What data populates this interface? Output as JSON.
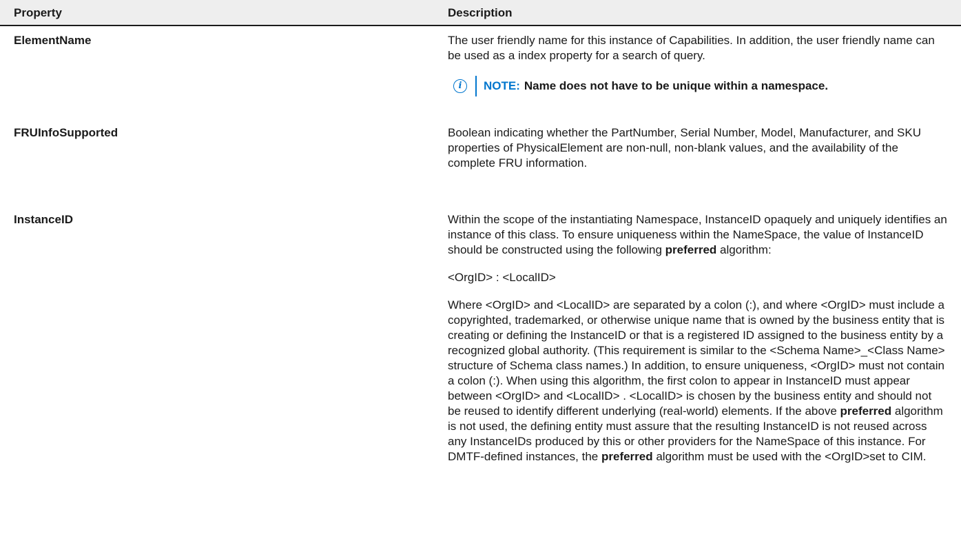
{
  "header": {
    "property": "Property",
    "description": "Description"
  },
  "rows": [
    {
      "name": "ElementName",
      "desc": "The user friendly name for this instance of Capabilities. In addition, the user friendly name can be used as a index property for a search of query.",
      "note": {
        "label": "NOTE:",
        "text": "Name does not have to be unique within a namespace."
      }
    },
    {
      "name": "FRUInfoSupported",
      "desc": "Boolean indicating whether the PartNumber, Serial Number, Model, Manufacturer, and SKU properties of PhysicalElement are non-null, non-blank values, and the availability of the complete FRU information."
    },
    {
      "name": "InstanceID",
      "p1a": "Within the scope of the instantiating Namespace, InstanceID opaquely and uniquely identifies an instance of this class. To ensure uniqueness within the NameSpace, the value of InstanceID should be constructed using the following ",
      "p1b": "preferred",
      "p1c": " algorithm:",
      "p2": "<OrgID> : <LocalID>",
      "p3a": "Where <OrgID> and <LocalID> are separated by a colon (:), and where <OrgID> must include a copyrighted, trademarked, or otherwise unique name that is owned by the business entity that is creating or defining the InstanceID or that is a registered ID assigned to the business entity by a recognized global authority. (This requirement is similar to the <Schema Name>_<Class Name> structure of Schema class names.) In addition, to ensure uniqueness, <OrgID> must not contain a colon (:). When using this algorithm, the first colon to appear in InstanceID must appear between <OrgID> and <LocalID> . <LocalID> is chosen by the business entity and should not be reused to identify different underlying (real-world) elements. If the above ",
      "p3b": "preferred",
      "p3c": " algorithm is not used, the defining entity must assure that the resulting InstanceID is not reused across any InstanceIDs produced by this or other providers for the NameSpace of this instance. For DMTF-defined instances, the ",
      "p3d": "preferred",
      "p3e": " algorithm must be used with the <OrgID>set to CIM."
    }
  ],
  "colors": {
    "accent": "#0076ce",
    "header_bg": "#eeeeee"
  },
  "icons": {
    "note": "info-circle-icon"
  }
}
